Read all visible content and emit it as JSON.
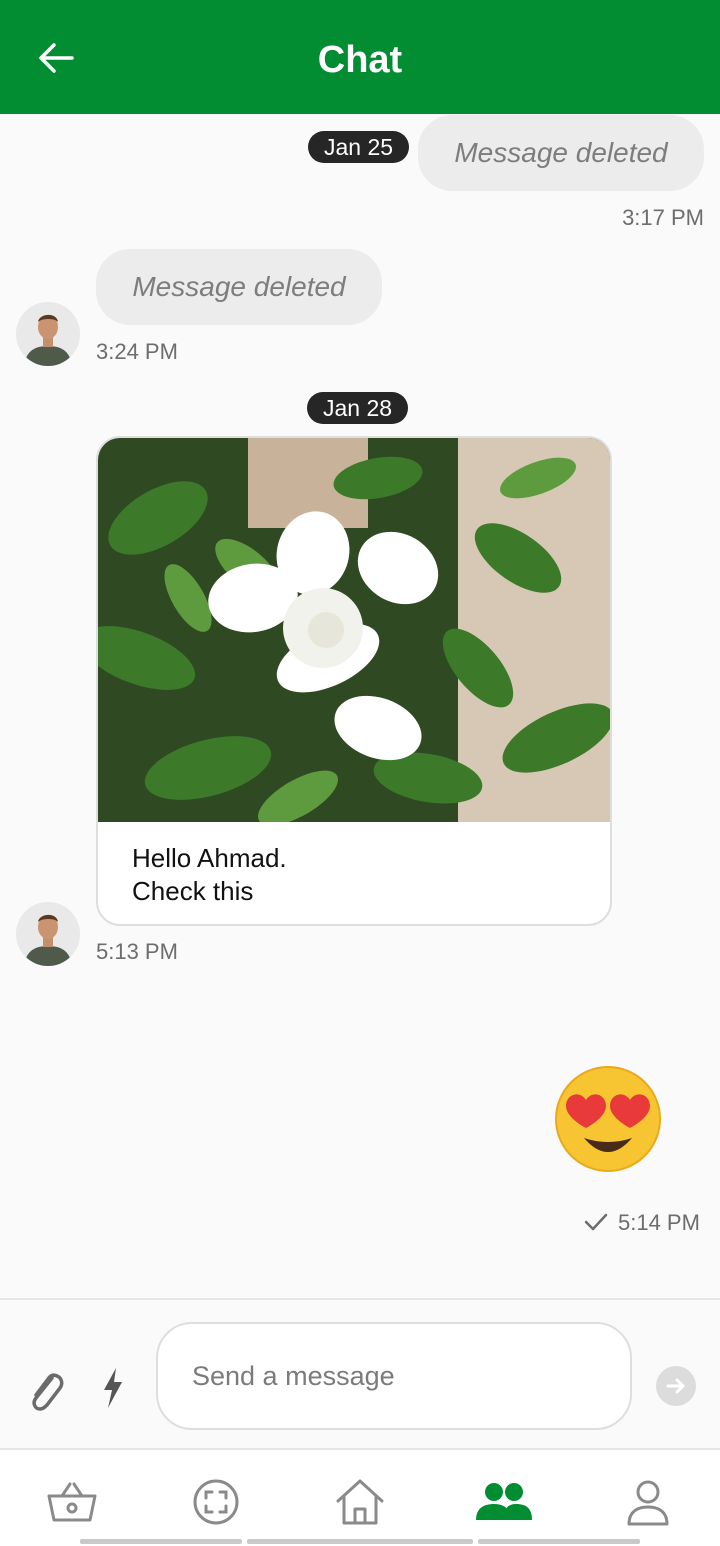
{
  "header": {
    "title": "Chat"
  },
  "messages": {
    "m1": {
      "date": "Jan 25",
      "text": "Message deleted",
      "time": "3:17 PM"
    },
    "m2": {
      "text": "Message deleted",
      "time": "3:24 PM"
    },
    "m3": {
      "date": "Jan 28",
      "caption_line1": "Hello Ahmad.",
      "caption_line2": "Check this",
      "time": "5:13 PM"
    },
    "m4": {
      "emoji": "smiling-face-with-heart-eyes",
      "time": "5:14 PM",
      "status": "sent"
    }
  },
  "composer": {
    "placeholder": "Send a message"
  },
  "nav": {
    "items": [
      "basket-icon",
      "scan-icon",
      "home-icon",
      "users-icon",
      "profile-icon"
    ],
    "active": "users-icon"
  },
  "colors": {
    "brand": "#028d33",
    "pill": "#262626",
    "deleted_bubble": "#ececec",
    "inactive_icon": "#8a8a8a"
  }
}
